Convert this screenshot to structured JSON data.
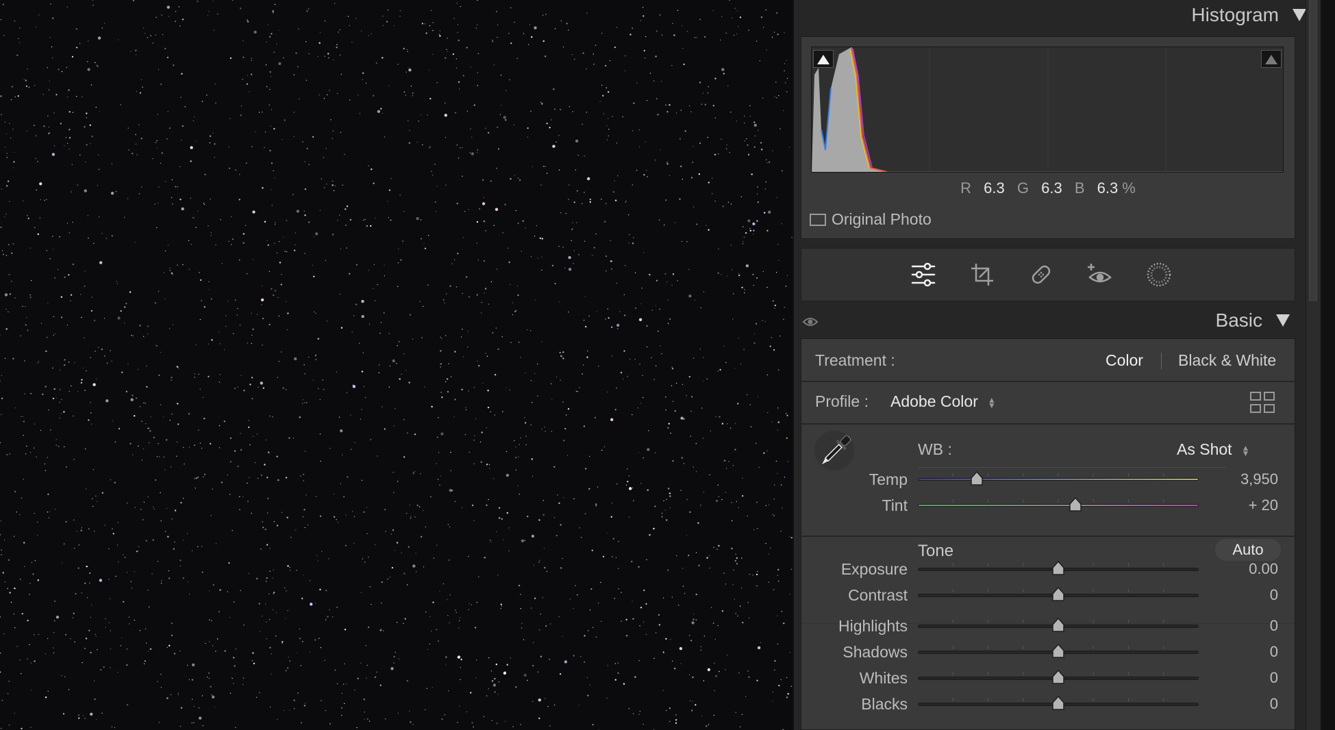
{
  "photo": {
    "description_icon": "starfield-photo"
  },
  "histogram": {
    "title": "Histogram",
    "r_label": "R",
    "r_value": "6.3",
    "g_label": "G",
    "g_value": "6.3",
    "b_label": "B",
    "b_value": "6.3",
    "unit": "%",
    "original_photo_label": "Original Photo"
  },
  "tools": [
    "edit-sliders-icon",
    "crop-icon",
    "healing-icon",
    "red-eye-icon",
    "masking-icon"
  ],
  "basic": {
    "title": "Basic",
    "treatment_label": "Treatment :",
    "treatment_color": "Color",
    "treatment_bw": "Black & White",
    "profile_label": "Profile :",
    "profile_value": "Adobe Color",
    "wb_label": "WB :",
    "wb_value": "As Shot",
    "tone_label": "Tone",
    "auto_label": "Auto",
    "sliders": [
      {
        "label": "Temp",
        "value": "3,950",
        "position": 0.21
      },
      {
        "label": "Tint",
        "value": "+ 20",
        "position": 0.56
      },
      {
        "label": "Exposure",
        "value": "0.00",
        "position": 0.5
      },
      {
        "label": "Contrast",
        "value": "0",
        "position": 0.5
      },
      {
        "label": "Highlights",
        "value": "0",
        "position": 0.5
      },
      {
        "label": "Shadows",
        "value": "0",
        "position": 0.5
      },
      {
        "label": "Whites",
        "value": "0",
        "position": 0.5
      },
      {
        "label": "Blacks",
        "value": "0",
        "position": 0.5
      }
    ]
  },
  "colors": {
    "panel_bg": "#262626",
    "section_bg": "#3a3a3a",
    "photo_bg": "#0b0a0c"
  }
}
